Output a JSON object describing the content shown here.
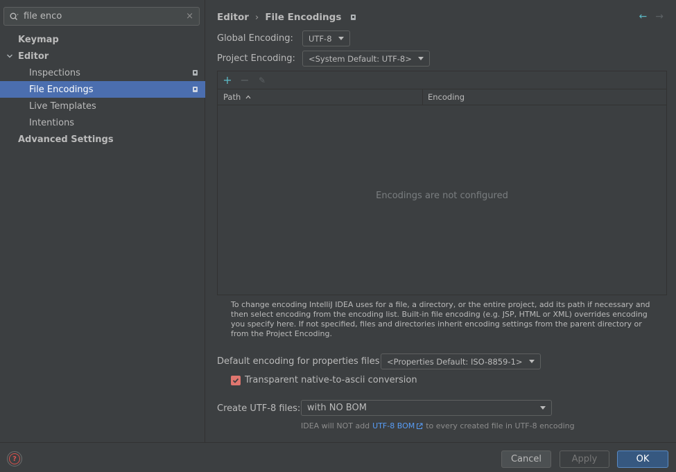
{
  "search": {
    "value": "file enco",
    "clear_label": "×"
  },
  "sidebar": {
    "items": [
      {
        "label": "Keymap"
      },
      {
        "label": "Editor"
      },
      {
        "label": "Inspections"
      },
      {
        "label": "File Encodings"
      },
      {
        "label": "Live Templates"
      },
      {
        "label": "Intentions"
      },
      {
        "label": "Advanced Settings"
      }
    ]
  },
  "breadcrumb": {
    "parent": "Editor",
    "separator": "›",
    "current": "File Encodings"
  },
  "nav": {
    "back": "←",
    "forward": "→"
  },
  "global_encoding": {
    "label": "Global Encoding:",
    "value": "UTF-8"
  },
  "project_encoding": {
    "label": "Project Encoding:",
    "value": "<System Default: UTF-8>"
  },
  "table": {
    "toolbar": {
      "add": "+",
      "remove": "−",
      "edit": "✎"
    },
    "columns": {
      "path": "Path",
      "encoding": "Encoding"
    },
    "empty_text": "Encodings are not configured"
  },
  "help_text": "To change encoding IntelliJ IDEA uses for a file, a directory, or the entire project, add its path if necessary and then select encoding from the encoding list. Built-in file encoding (e.g. JSP, HTML or XML) overrides encoding you specify here. If not specified, files and directories inherit encoding settings from the parent directory or from the Project Encoding.",
  "properties_encoding": {
    "label": "Default encoding for properties files:",
    "value": "<Properties Default: ISO-8859-1>"
  },
  "native_to_ascii": {
    "label": "Transparent native-to-ascii conversion",
    "checked": true
  },
  "utf8_files": {
    "label": "Create UTF-8 files:",
    "value": "with NO BOM"
  },
  "bom_info": {
    "before": "IDEA will NOT add",
    "link": "UTF-8 BOM",
    "after": "to every created file in UTF-8 encoding"
  },
  "footer": {
    "cancel": "Cancel",
    "apply": "Apply",
    "ok": "OK",
    "help": "?"
  },
  "colors": {
    "selection": "#4b6eaf",
    "accent": "#5cb8c4",
    "checkbox": "#e0766f",
    "link": "#589df6",
    "ok_button": "#365880"
  }
}
